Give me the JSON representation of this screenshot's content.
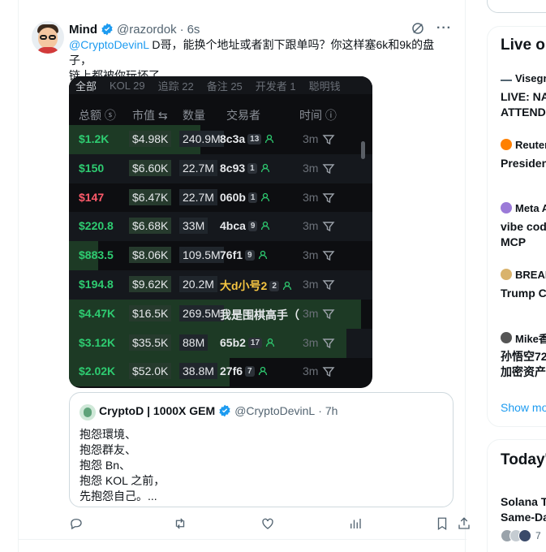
{
  "tweet": {
    "name": "Mind",
    "handle": "@razordok",
    "dot": "·",
    "time": "6s",
    "more": "···",
    "mention": "@CryptoDevinL",
    "text_line1": " D哥，能换个地址或者割下跟单吗？你这样塞6k和9k的盘子，",
    "text_line2": "链上都被你玩坏了"
  },
  "screenshot": {
    "tabs": [
      "全部",
      "KOL 29",
      "追踪 22",
      "备注 25",
      "开发者 1",
      "聪明钱"
    ],
    "headers": {
      "total": "总额 ⓢ",
      "mcap": "市值 ⇆",
      "qty": "数量",
      "trader": "交易者",
      "time": "时间 ⓘ"
    },
    "rows": [
      {
        "total": "$1.2K",
        "color": "#2ecc71",
        "mcap": "$4.98K",
        "qty": "240.9M",
        "trader": "8c3a",
        "badge": "13",
        "time": "3m",
        "hl": 45
      },
      {
        "total": "$150",
        "color": "#2ecc71",
        "mcap": "$6.60K",
        "qty": "22.7M",
        "trader": "8c93",
        "badge": "1",
        "time": "3m",
        "hl": 0
      },
      {
        "total": "$147",
        "color": "#ff5a6a",
        "mcap": "$6.47K",
        "qty": "22.7M",
        "trader": "060b",
        "badge": "1",
        "time": "3m",
        "hl": 0
      },
      {
        "total": "$220.8",
        "color": "#2ecc71",
        "mcap": "$6.68K",
        "qty": "33M",
        "trader": "4bca",
        "badge": "9",
        "time": "3m",
        "hl": 0
      },
      {
        "total": "$883.5",
        "color": "#2ecc71",
        "mcap": "$8.06K",
        "qty": "109.5M",
        "trader": "76f1",
        "badge": "9",
        "time": "3m",
        "hl": 10
      },
      {
        "total": "$194.8",
        "color": "#2ecc71",
        "mcap": "$9.62K",
        "qty": "20.2M",
        "trader": "大d小号2",
        "badge": "2",
        "time": "3m",
        "hl": 0
      },
      {
        "total": "$4.47K",
        "color": "#2ecc71",
        "mcap": "$16.5K",
        "qty": "269.5M",
        "trader": "我是围棋高手（",
        "badge": "",
        "time": "3m",
        "hl": 100
      },
      {
        "total": "$3.12K",
        "color": "#2ecc71",
        "mcap": "$35.5K",
        "qty": "88M",
        "trader": "65b2",
        "badge": "17",
        "time": "3m",
        "hl": 95
      },
      {
        "total": "$2.02K",
        "color": "#2ecc71",
        "mcap": "$52.0K",
        "qty": "38.8M",
        "trader": "27f6",
        "badge": "7",
        "time": "3m",
        "hl": 55
      }
    ]
  },
  "quote": {
    "name": "CryptoD | 1000X GEM",
    "handle": "@CryptoDevinL",
    "dot": "·",
    "time": "7h",
    "lines": [
      "抱怨環境、",
      "抱怨群友、",
      "抱怨 Bn、",
      "抱怨 KOL 之前，",
      "先抱怨自己。..."
    ]
  },
  "actions": [
    "reply-icon",
    "retweet-icon",
    "like-icon",
    "views-icon",
    "bookmark-icon",
    "share-icon"
  ],
  "sidebar": {
    "live_title": "Live on",
    "items": [
      {
        "src": "Visegra",
        "text1": "LIVE: NAT",
        "text2": "ATTENDS",
        "color": "#536471"
      },
      {
        "src": "Reuters",
        "text1": "Presiden",
        "text2": "",
        "color": "#ff8000"
      },
      {
        "src": "Meta Al",
        "text1": "vibe codi",
        "text2": "MCP",
        "color": "#9b7ad8"
      },
      {
        "src": "BREAD",
        "text1": "Trump Ca",
        "text2": "",
        "color": "#d9b36c"
      },
      {
        "src": "Mike香",
        "text1": "孙悟空72",
        "text2": "加密资产",
        "color": "#555"
      }
    ],
    "show_more": "Show mo",
    "today_title": "Today's",
    "today_item1": "Solana T",
    "today_item2": "Same-Da",
    "today_count": "7"
  },
  "colors": {
    "accent": "#1d9bf0",
    "positive": "#2ecc71",
    "negative": "#ff5a6a"
  }
}
